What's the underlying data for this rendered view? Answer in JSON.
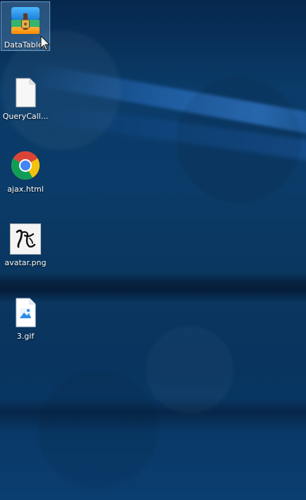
{
  "desktop": {
    "icons": [
      {
        "label": "DataTables",
        "icon": "archive-icon",
        "selected": true
      },
      {
        "label": "QueryCall...",
        "icon": "file-icon",
        "selected": false
      },
      {
        "label": "ajax.html",
        "icon": "chrome-icon",
        "selected": false
      },
      {
        "label": "avatar.png",
        "icon": "avatar-image-icon",
        "selected": false
      },
      {
        "label": "3.gif",
        "icon": "image-file-icon",
        "selected": false
      }
    ]
  },
  "colors": {
    "wallpaper_top": "#06284d",
    "wallpaper_mid": "#0b3b68",
    "wallpaper_bottom": "#0a3e70",
    "selection_fill": "#73aadc",
    "text": "#ffffff"
  }
}
